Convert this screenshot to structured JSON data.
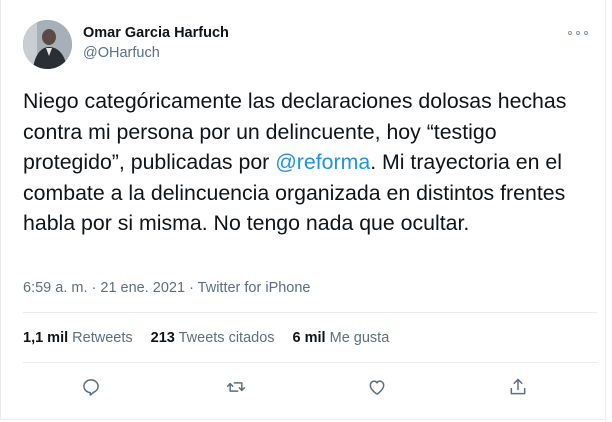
{
  "user": {
    "name": "Omar Garcia Harfuch",
    "handle": "@OHarfuch"
  },
  "tweet": {
    "text_before": "Niego categóricamente las declaraciones dolosas hechas contra mi persona por un delincuente, hoy “testigo protegido”, publicadas por ",
    "mention": "@reforma",
    "text_after": ". Mi trayectoria en el combate a la delincuencia organizada en distintos frentes habla por si misma. No tengo nada que ocultar."
  },
  "meta": {
    "time": "6:59 a. m.",
    "sep1": " · ",
    "date": "21 ene. 2021",
    "sep2": " · ",
    "source": "Twitter for iPhone"
  },
  "stats": {
    "retweets_count": "1,1 mil",
    "retweets_label": "Retweets",
    "quotes_count": "213",
    "quotes_label": "Tweets citados",
    "likes_count": "6 mil",
    "likes_label": "Me gusta"
  },
  "icons": {
    "more": "more-options-icon",
    "reply": "reply-icon",
    "retweet": "retweet-icon",
    "like": "like-icon",
    "share": "share-icon"
  },
  "colors": {
    "link": "#1b95e0",
    "secondary_text": "#5b7083",
    "icon": "#5b7083",
    "divider": "#e6ecf0"
  }
}
